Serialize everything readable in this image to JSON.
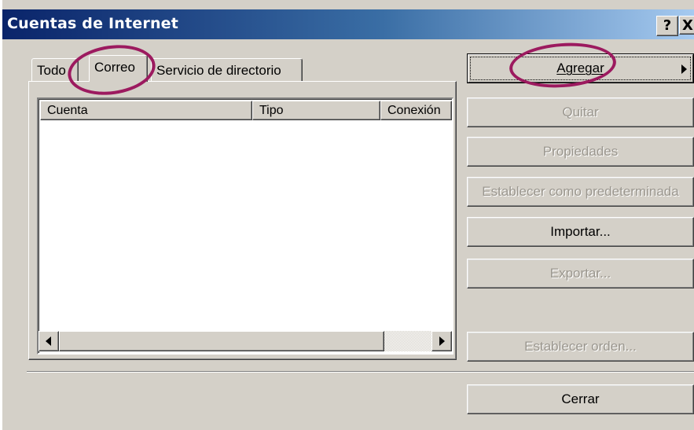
{
  "window": {
    "title": "Cuentas de Internet",
    "help_glyph": "?",
    "close_glyph": "X"
  },
  "tabs": [
    {
      "label": "Todo"
    },
    {
      "label": "Correo"
    },
    {
      "label": "Servicio de directorio"
    }
  ],
  "list": {
    "columns": [
      "Cuenta",
      "Tipo",
      "Conexión"
    ]
  },
  "buttons": {
    "agregar": {
      "label": "Agregar",
      "enabled": true
    },
    "quitar": {
      "label": "Quitar",
      "enabled": false
    },
    "propiedades": {
      "label": "Propiedades",
      "enabled": false
    },
    "predeterminada": {
      "label": "Establecer como predeterminada",
      "enabled": false
    },
    "importar": {
      "label": "Importar...",
      "enabled": true
    },
    "exportar": {
      "label": "Exportar...",
      "enabled": false
    },
    "orden": {
      "label": "Establecer orden...",
      "enabled": false
    },
    "cerrar": {
      "label": "Cerrar",
      "enabled": true
    }
  },
  "colors": {
    "title_bar_start": "#0a246a",
    "title_bar_end": "#a6caf0",
    "annotation_circle": "#9c1a5f",
    "dialog_face": "#d4d0c8"
  }
}
